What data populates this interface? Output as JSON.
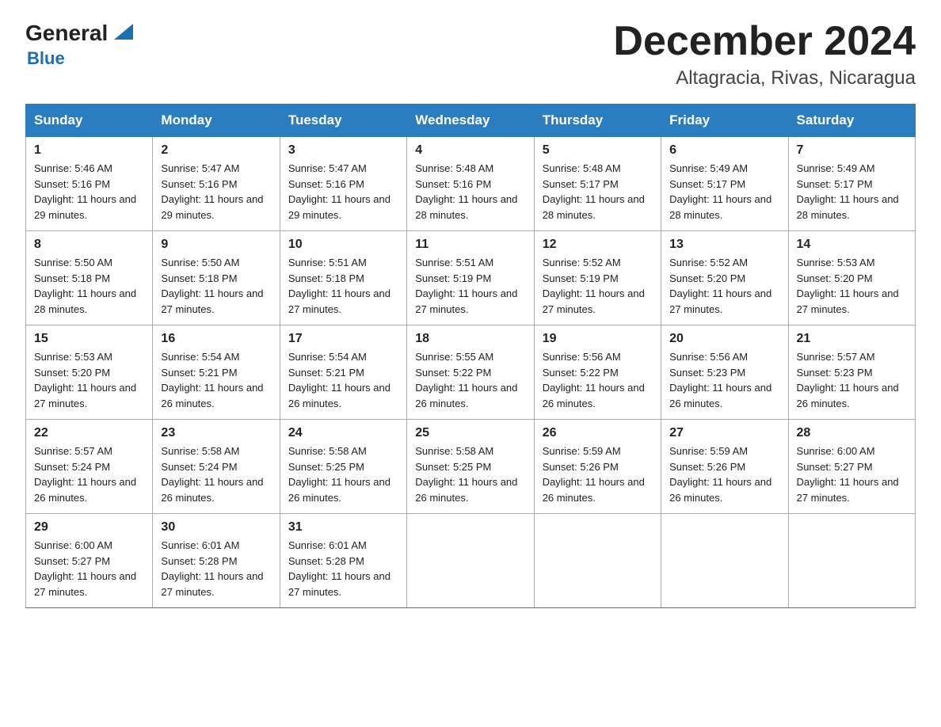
{
  "header": {
    "logo_general": "General",
    "logo_blue": "Blue",
    "month_title": "December 2024",
    "location": "Altagracia, Rivas, Nicaragua"
  },
  "days_of_week": [
    "Sunday",
    "Monday",
    "Tuesday",
    "Wednesday",
    "Thursday",
    "Friday",
    "Saturday"
  ],
  "weeks": [
    [
      {
        "day": "1",
        "sunrise": "5:46 AM",
        "sunset": "5:16 PM",
        "daylight": "11 hours and 29 minutes."
      },
      {
        "day": "2",
        "sunrise": "5:47 AM",
        "sunset": "5:16 PM",
        "daylight": "11 hours and 29 minutes."
      },
      {
        "day": "3",
        "sunrise": "5:47 AM",
        "sunset": "5:16 PM",
        "daylight": "11 hours and 29 minutes."
      },
      {
        "day": "4",
        "sunrise": "5:48 AM",
        "sunset": "5:16 PM",
        "daylight": "11 hours and 28 minutes."
      },
      {
        "day": "5",
        "sunrise": "5:48 AM",
        "sunset": "5:17 PM",
        "daylight": "11 hours and 28 minutes."
      },
      {
        "day": "6",
        "sunrise": "5:49 AM",
        "sunset": "5:17 PM",
        "daylight": "11 hours and 28 minutes."
      },
      {
        "day": "7",
        "sunrise": "5:49 AM",
        "sunset": "5:17 PM",
        "daylight": "11 hours and 28 minutes."
      }
    ],
    [
      {
        "day": "8",
        "sunrise": "5:50 AM",
        "sunset": "5:18 PM",
        "daylight": "11 hours and 28 minutes."
      },
      {
        "day": "9",
        "sunrise": "5:50 AM",
        "sunset": "5:18 PM",
        "daylight": "11 hours and 27 minutes."
      },
      {
        "day": "10",
        "sunrise": "5:51 AM",
        "sunset": "5:18 PM",
        "daylight": "11 hours and 27 minutes."
      },
      {
        "day": "11",
        "sunrise": "5:51 AM",
        "sunset": "5:19 PM",
        "daylight": "11 hours and 27 minutes."
      },
      {
        "day": "12",
        "sunrise": "5:52 AM",
        "sunset": "5:19 PM",
        "daylight": "11 hours and 27 minutes."
      },
      {
        "day": "13",
        "sunrise": "5:52 AM",
        "sunset": "5:20 PM",
        "daylight": "11 hours and 27 minutes."
      },
      {
        "day": "14",
        "sunrise": "5:53 AM",
        "sunset": "5:20 PM",
        "daylight": "11 hours and 27 minutes."
      }
    ],
    [
      {
        "day": "15",
        "sunrise": "5:53 AM",
        "sunset": "5:20 PM",
        "daylight": "11 hours and 27 minutes."
      },
      {
        "day": "16",
        "sunrise": "5:54 AM",
        "sunset": "5:21 PM",
        "daylight": "11 hours and 26 minutes."
      },
      {
        "day": "17",
        "sunrise": "5:54 AM",
        "sunset": "5:21 PM",
        "daylight": "11 hours and 26 minutes."
      },
      {
        "day": "18",
        "sunrise": "5:55 AM",
        "sunset": "5:22 PM",
        "daylight": "11 hours and 26 minutes."
      },
      {
        "day": "19",
        "sunrise": "5:56 AM",
        "sunset": "5:22 PM",
        "daylight": "11 hours and 26 minutes."
      },
      {
        "day": "20",
        "sunrise": "5:56 AM",
        "sunset": "5:23 PM",
        "daylight": "11 hours and 26 minutes."
      },
      {
        "day": "21",
        "sunrise": "5:57 AM",
        "sunset": "5:23 PM",
        "daylight": "11 hours and 26 minutes."
      }
    ],
    [
      {
        "day": "22",
        "sunrise": "5:57 AM",
        "sunset": "5:24 PM",
        "daylight": "11 hours and 26 minutes."
      },
      {
        "day": "23",
        "sunrise": "5:58 AM",
        "sunset": "5:24 PM",
        "daylight": "11 hours and 26 minutes."
      },
      {
        "day": "24",
        "sunrise": "5:58 AM",
        "sunset": "5:25 PM",
        "daylight": "11 hours and 26 minutes."
      },
      {
        "day": "25",
        "sunrise": "5:58 AM",
        "sunset": "5:25 PM",
        "daylight": "11 hours and 26 minutes."
      },
      {
        "day": "26",
        "sunrise": "5:59 AM",
        "sunset": "5:26 PM",
        "daylight": "11 hours and 26 minutes."
      },
      {
        "day": "27",
        "sunrise": "5:59 AM",
        "sunset": "5:26 PM",
        "daylight": "11 hours and 26 minutes."
      },
      {
        "day": "28",
        "sunrise": "6:00 AM",
        "sunset": "5:27 PM",
        "daylight": "11 hours and 27 minutes."
      }
    ],
    [
      {
        "day": "29",
        "sunrise": "6:00 AM",
        "sunset": "5:27 PM",
        "daylight": "11 hours and 27 minutes."
      },
      {
        "day": "30",
        "sunrise": "6:01 AM",
        "sunset": "5:28 PM",
        "daylight": "11 hours and 27 minutes."
      },
      {
        "day": "31",
        "sunrise": "6:01 AM",
        "sunset": "5:28 PM",
        "daylight": "11 hours and 27 minutes."
      },
      null,
      null,
      null,
      null
    ]
  ]
}
